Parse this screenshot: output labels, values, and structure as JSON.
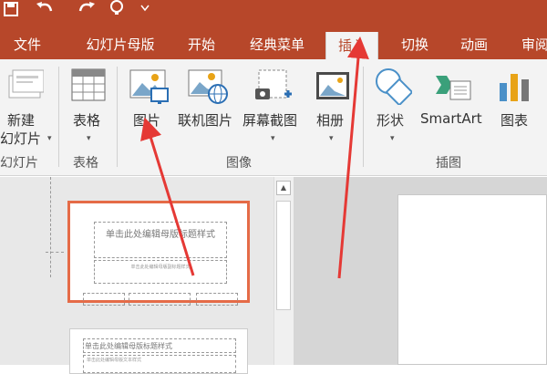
{
  "colors": {
    "accent": "#b7472a",
    "arrow": "#e53935"
  },
  "tabs": [
    {
      "label": "文件"
    },
    {
      "label": "幻灯片母版"
    },
    {
      "label": "开始"
    },
    {
      "label": "经典菜单"
    },
    {
      "label": "插入"
    },
    {
      "label": "切换"
    },
    {
      "label": "动画"
    },
    {
      "label": "审阅"
    }
  ],
  "active_tab": "插入",
  "ribbon": {
    "new_slide": {
      "line1": "新建",
      "line2": "幻灯片",
      "icon": "new-slide-icon"
    },
    "table": {
      "label": "表格",
      "icon": "table-icon"
    },
    "picture": {
      "label": "图片",
      "icon": "picture-icon"
    },
    "online_picture": {
      "label": "联机图片",
      "icon": "online-picture-icon"
    },
    "screenshot": {
      "label": "屏幕截图",
      "icon": "screenshot-icon"
    },
    "album": {
      "label": "相册",
      "icon": "photo-album-icon"
    },
    "shapes": {
      "label": "形状",
      "icon": "shapes-icon"
    },
    "smartart": {
      "label": "SmartArt",
      "icon": "smartart-icon"
    },
    "chart": {
      "label": "图表",
      "icon": "chart-icon"
    },
    "groups": {
      "slides": "幻灯片",
      "tables": "表格",
      "images": "图像",
      "illustrations": "插图"
    }
  },
  "thumbnails": [
    {
      "title": "单击此处编辑母版标题样式",
      "subtitle": "单击此处编辑母版副标题样式",
      "selected": true
    },
    {
      "title": "单击此处编辑母版标题样式",
      "subtitle": "单击此处编辑母版文本样式"
    }
  ]
}
